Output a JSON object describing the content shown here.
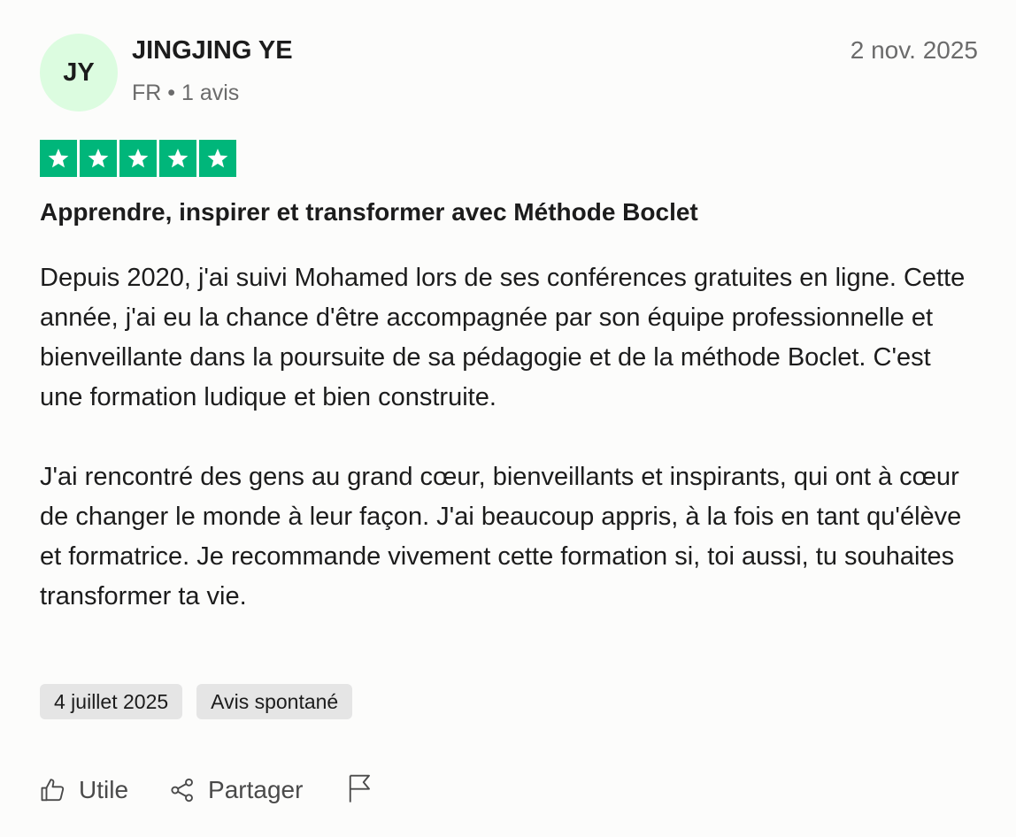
{
  "author": {
    "initials": "JY",
    "name": "JINGJING YE",
    "meta": "FR • 1 avis",
    "avatar_color": "#dcfce0"
  },
  "review": {
    "date": "2 nov. 2025",
    "rating": 5,
    "star_color": "#00b67a",
    "title": "Apprendre, inspirer et transformer avec Méthode Boclet",
    "paragraphs": [
      "Depuis 2020, j'ai suivi Mohamed lors de ses conférences gratuites en ligne. Cette année, j'ai eu la chance d'être accompagnée par son équipe professionnelle et bienveillante dans la poursuite de sa pédagogie et de la méthode Boclet. C'est une formation ludique et bien construite.",
      "J'ai rencontré des gens au grand cœur, bienveillants et inspirants, qui ont à cœur de changer le monde à leur façon. J'ai beaucoup appris, à la fois en tant qu'élève et formatrice. Je recommande vivement cette formation si, toi aussi, tu souhaites transformer ta vie."
    ],
    "tags": [
      "4 juillet 2025",
      "Avis spontané"
    ]
  },
  "actions": {
    "useful_label": "Utile",
    "useful_icon": "thumbs-up-icon",
    "share_label": "Partager",
    "share_icon": "share-icon",
    "report_icon": "flag-icon"
  }
}
